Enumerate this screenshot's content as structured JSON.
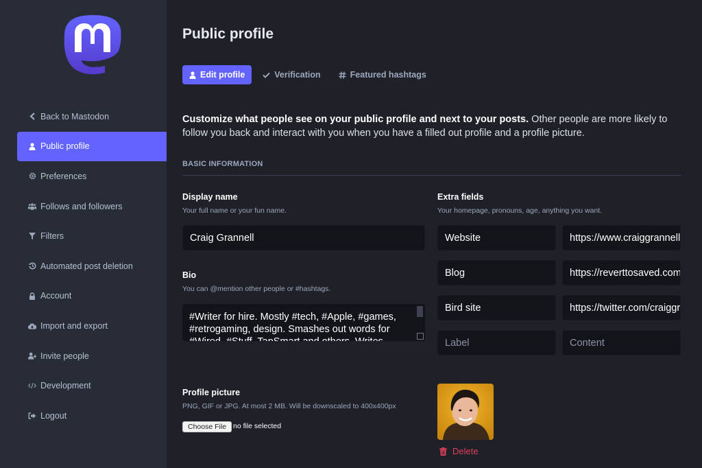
{
  "colors": {
    "accent": "#6364ff",
    "sidebar_bg": "#282c37",
    "main_bg": "#1f2028",
    "input_bg": "#131419",
    "danger": "#df405a"
  },
  "sidebar": {
    "logo": "mastodon-logo",
    "items": [
      {
        "label": "Back to Mastodon",
        "icon": "chevron-left-icon",
        "active": false
      },
      {
        "label": "Public profile",
        "icon": "user-icon",
        "active": true
      },
      {
        "label": "Preferences",
        "icon": "gear-icon",
        "active": false
      },
      {
        "label": "Follows and followers",
        "icon": "users-icon",
        "active": false
      },
      {
        "label": "Filters",
        "icon": "filter-icon",
        "active": false
      },
      {
        "label": "Automated post deletion",
        "icon": "history-icon",
        "active": false
      },
      {
        "label": "Account",
        "icon": "lock-icon",
        "active": false
      },
      {
        "label": "Import and export",
        "icon": "cloud-download-icon",
        "active": false
      },
      {
        "label": "Invite people",
        "icon": "user-plus-icon",
        "active": false
      },
      {
        "label": "Development",
        "icon": "code-icon",
        "active": false
      },
      {
        "label": "Logout",
        "icon": "sign-out-icon",
        "active": false
      }
    ]
  },
  "header": {
    "title": "Public profile",
    "tabs": [
      {
        "label": "Edit profile",
        "icon": "user-icon",
        "active": true
      },
      {
        "label": "Verification",
        "icon": "check-icon",
        "active": false
      },
      {
        "label": "Featured hashtags",
        "icon": "hashtag-icon",
        "active": false
      }
    ]
  },
  "intro": {
    "bold": "Customize what people see on your public profile and next to your posts.",
    "rest": " Other people are more likely to follow you back and interact with you when you have a filled out profile and a profile picture."
  },
  "section": {
    "title": "BASIC INFORMATION"
  },
  "display_name": {
    "label": "Display name",
    "hint": "Your full name or your fun name.",
    "value": "Craig Grannell"
  },
  "bio": {
    "label": "Bio",
    "hint": "You can @mention other people or #hashtags.",
    "value": "#Writer for hire. Mostly #tech, #Apple, #games, #retrogaming, design. Smashes out words for #Wired, #Stuff, TapSmart and others. Writes"
  },
  "extra_fields": {
    "label": "Extra fields",
    "hint": "Your homepage, pronouns, age, anything you want.",
    "rows": [
      {
        "name": "Website",
        "value": "https://www.craiggrannell.com"
      },
      {
        "name": "Blog",
        "value": "https://reverttosaved.com"
      },
      {
        "name": "Bird site",
        "value": "https://twitter.com/craiggrannell"
      },
      {
        "name": "",
        "value": "",
        "name_placeholder": "Label",
        "value_placeholder": "Content"
      }
    ]
  },
  "profile_picture": {
    "label": "Profile picture",
    "hint": "PNG, GIF or JPG. At most 2 MB. Will be downscaled to 400x400px",
    "choose_button": "Choose File",
    "file_status": "no file selected",
    "delete_label": "Delete"
  }
}
